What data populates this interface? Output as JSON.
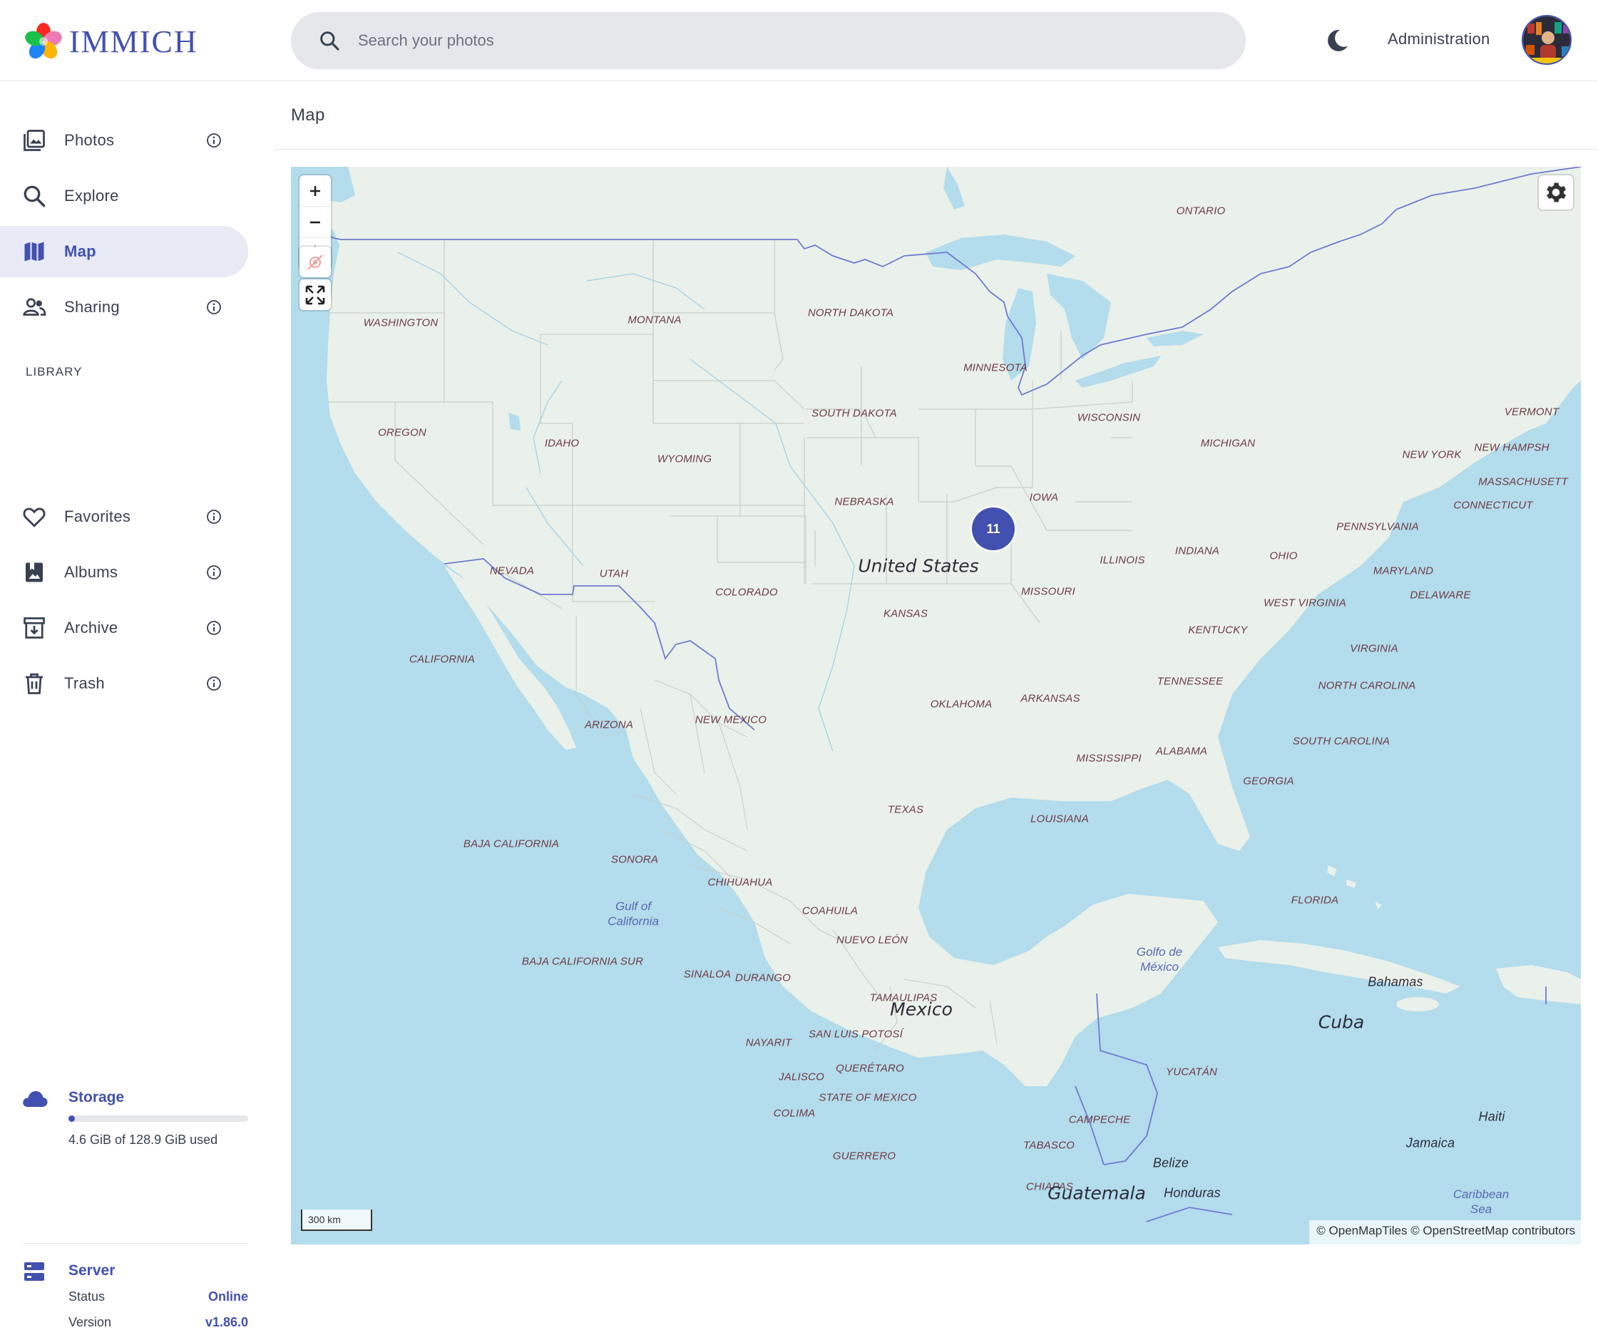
{
  "app": {
    "brand_name": "IMMICH",
    "brand_color": "#4250af"
  },
  "header": {
    "search_placeholder": "Search your photos",
    "theme_icon": "moon-icon",
    "admin_label": "Administration",
    "avatar_icon": "user-avatar"
  },
  "sidebar": {
    "items": [
      {
        "label": "Photos",
        "icon": "photos-icon",
        "info": true
      },
      {
        "label": "Explore",
        "icon": "search-icon",
        "info": false
      },
      {
        "label": "Map",
        "icon": "map-icon",
        "info": false,
        "active": true
      },
      {
        "label": "Sharing",
        "icon": "sharing-icon",
        "info": true
      }
    ],
    "library_heading": "LIBRARY",
    "library_items": [
      {
        "label": "Favorites",
        "icon": "heart-icon",
        "info": true
      },
      {
        "label": "Albums",
        "icon": "album-icon",
        "info": true
      },
      {
        "label": "Archive",
        "icon": "archive-icon",
        "info": true
      },
      {
        "label": "Trash",
        "icon": "trash-icon",
        "info": true
      }
    ],
    "storage": {
      "title": "Storage",
      "usage_text": "4.6 GiB of 128.9 GiB used",
      "used_fraction": 0.036
    },
    "server": {
      "title": "Server",
      "status_label": "Status",
      "status_value": "Online",
      "version_label": "Version",
      "version_value": "v1.86.0"
    }
  },
  "main": {
    "page_title": "Map"
  },
  "map": {
    "cluster_count": "11",
    "scale_label": "300 km",
    "attribution": "© OpenMapTiles © OpenStreetMap contributors",
    "country_labels": [
      "United States",
      "Mexico",
      "Cuba",
      "Guatemala"
    ],
    "place_labels": [
      "Belize",
      "Honduras",
      "Jamaica",
      "Haiti",
      "Bahamas"
    ],
    "water_labels": [
      [
        "Gulf of",
        "California"
      ],
      [
        "Golfo de",
        "México"
      ],
      [
        "Caribbean",
        "Sea"
      ]
    ],
    "region_labels": [
      "ONTARIO",
      "WASHINGTON",
      "MONTANA",
      "NORTH DAKOTA",
      "MINNESOTA",
      "OREGON",
      "IDAHO",
      "WYOMING",
      "SOUTH DAKOTA",
      "WISCONSIN",
      "MICHIGAN",
      "VERMONT",
      "NEW HAMPSH",
      "NEW YORK",
      "MASSACHUSETT",
      "CONNECTICUT",
      "NEBRASKA",
      "IOWA",
      "PENNSYLVANIA",
      "NEVADA",
      "UTAH",
      "ILLINOIS",
      "INDIANA",
      "OHIO",
      "MARYLAND",
      "DELAWARE",
      "COLORADO",
      "KANSAS",
      "MISSOURI",
      "WEST VIRGINIA",
      "CALIFORNIA",
      "KENTUCKY",
      "VIRGINIA",
      "TENNESSEE",
      "NORTH CAROLINA",
      "OKLAHOMA",
      "ARKANSAS",
      "ARIZONA",
      "NEW MEXICO",
      "MISSISSIPPI",
      "ALABAMA",
      "SOUTH CAROLINA",
      "GEORGIA",
      "TEXAS",
      "LOUISIANA",
      "BAJA CALIFORNIA",
      "SONORA",
      "CHIHUAHUA",
      "FLORIDA",
      "COAHUILA",
      "NUEVO LEÓN",
      "BAJA CALIFORNIA SUR",
      "SINALOA",
      "DURANGO",
      "TAMAULIPAS",
      "NAYARIT",
      "SAN LUIS POTOSÍ",
      "YUCATÁN",
      "JALISCO",
      "QUERÉTARO",
      "STATE OF MEXICO",
      "COLIMA",
      "CAMPECHE",
      "TABASCO",
      "GUERRERO",
      "CHIAPAS"
    ]
  }
}
